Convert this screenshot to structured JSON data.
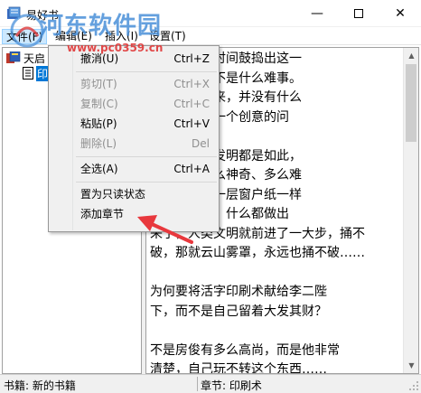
{
  "window": {
    "title": "易好书",
    "minimize_glyph": "—",
    "close_glyph": "✕"
  },
  "menubar": {
    "file": "文件(F)",
    "edit": "编辑(E)",
    "insert": "插入(I)",
    "settings": "设置(T)"
  },
  "watermark": {
    "title": "河东软件园",
    "url": "www.pc0359.cn"
  },
  "tree": {
    "root_label": "天启",
    "child_label": "印"
  },
  "text_lines": [
    "                  出，几个月时间鼓捣出这一",
    "                  创造，其实不是什么难事。",
    "                  两严格说起来，并没有什么",
    "                  充其量就是一个创意的问",
    "",
    "                  史上的很多发明都是如此，",
    "                  样东西有多么神奇、多么难",
    "                  就难在就如一层窗户纸一样",
    "                  上。捅破了，什么都做出",
    "来了，人类文明就前进了一大步，捅不",
    "破，那就云山雾罩，永远也捅不破……",
    "",
    "      为何要将活字印刷术献给李二陛",
    "下，而不是自己留着大发其财？",
    "",
    "      不是房俊有多么高尚，而是他非常",
    "清楚，自己玩不转这个东西……"
  ],
  "context_menu": {
    "items": [
      {
        "label": "撤消(U)",
        "shortcut": "Ctrl+Z",
        "enabled": true
      },
      {
        "label": "剪切(T)",
        "shortcut": "Ctrl+X",
        "enabled": false
      },
      {
        "label": "复制(C)",
        "shortcut": "Ctrl+C",
        "enabled": false
      },
      {
        "label": "粘贴(P)",
        "shortcut": "Ctrl+V",
        "enabled": true
      },
      {
        "label": "删除(L)",
        "shortcut": "Del",
        "enabled": false
      },
      {
        "label": "全选(A)",
        "shortcut": "Ctrl+A",
        "enabled": true
      },
      {
        "label": "置为只读状态",
        "shortcut": "",
        "enabled": true
      },
      {
        "label": "添加章节",
        "shortcut": "",
        "enabled": true
      }
    ]
  },
  "statusbar": {
    "book": "书籍: 新的书籍",
    "chapter": "章节: 印刷术"
  },
  "colors": {
    "annotation_arrow": "#e8383d",
    "menu_highlight": "#cce8ff",
    "disabled_text": "#8f8f8f"
  }
}
